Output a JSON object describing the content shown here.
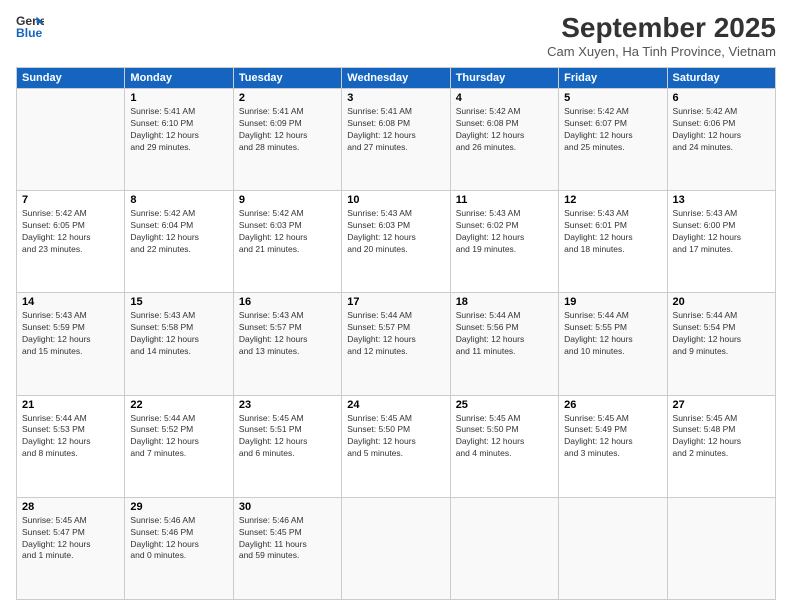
{
  "header": {
    "logo_line1": "General",
    "logo_line2": "Blue",
    "month_title": "September 2025",
    "subtitle": "Cam Xuyen, Ha Tinh Province, Vietnam"
  },
  "days_of_week": [
    "Sunday",
    "Monday",
    "Tuesday",
    "Wednesday",
    "Thursday",
    "Friday",
    "Saturday"
  ],
  "weeks": [
    [
      {
        "day": "",
        "info": ""
      },
      {
        "day": "1",
        "info": "Sunrise: 5:41 AM\nSunset: 6:10 PM\nDaylight: 12 hours\nand 29 minutes."
      },
      {
        "day": "2",
        "info": "Sunrise: 5:41 AM\nSunset: 6:09 PM\nDaylight: 12 hours\nand 28 minutes."
      },
      {
        "day": "3",
        "info": "Sunrise: 5:41 AM\nSunset: 6:08 PM\nDaylight: 12 hours\nand 27 minutes."
      },
      {
        "day": "4",
        "info": "Sunrise: 5:42 AM\nSunset: 6:08 PM\nDaylight: 12 hours\nand 26 minutes."
      },
      {
        "day": "5",
        "info": "Sunrise: 5:42 AM\nSunset: 6:07 PM\nDaylight: 12 hours\nand 25 minutes."
      },
      {
        "day": "6",
        "info": "Sunrise: 5:42 AM\nSunset: 6:06 PM\nDaylight: 12 hours\nand 24 minutes."
      }
    ],
    [
      {
        "day": "7",
        "info": "Sunrise: 5:42 AM\nSunset: 6:05 PM\nDaylight: 12 hours\nand 23 minutes."
      },
      {
        "day": "8",
        "info": "Sunrise: 5:42 AM\nSunset: 6:04 PM\nDaylight: 12 hours\nand 22 minutes."
      },
      {
        "day": "9",
        "info": "Sunrise: 5:42 AM\nSunset: 6:03 PM\nDaylight: 12 hours\nand 21 minutes."
      },
      {
        "day": "10",
        "info": "Sunrise: 5:43 AM\nSunset: 6:03 PM\nDaylight: 12 hours\nand 20 minutes."
      },
      {
        "day": "11",
        "info": "Sunrise: 5:43 AM\nSunset: 6:02 PM\nDaylight: 12 hours\nand 19 minutes."
      },
      {
        "day": "12",
        "info": "Sunrise: 5:43 AM\nSunset: 6:01 PM\nDaylight: 12 hours\nand 18 minutes."
      },
      {
        "day": "13",
        "info": "Sunrise: 5:43 AM\nSunset: 6:00 PM\nDaylight: 12 hours\nand 17 minutes."
      }
    ],
    [
      {
        "day": "14",
        "info": "Sunrise: 5:43 AM\nSunset: 5:59 PM\nDaylight: 12 hours\nand 15 minutes."
      },
      {
        "day": "15",
        "info": "Sunrise: 5:43 AM\nSunset: 5:58 PM\nDaylight: 12 hours\nand 14 minutes."
      },
      {
        "day": "16",
        "info": "Sunrise: 5:43 AM\nSunset: 5:57 PM\nDaylight: 12 hours\nand 13 minutes."
      },
      {
        "day": "17",
        "info": "Sunrise: 5:44 AM\nSunset: 5:57 PM\nDaylight: 12 hours\nand 12 minutes."
      },
      {
        "day": "18",
        "info": "Sunrise: 5:44 AM\nSunset: 5:56 PM\nDaylight: 12 hours\nand 11 minutes."
      },
      {
        "day": "19",
        "info": "Sunrise: 5:44 AM\nSunset: 5:55 PM\nDaylight: 12 hours\nand 10 minutes."
      },
      {
        "day": "20",
        "info": "Sunrise: 5:44 AM\nSunset: 5:54 PM\nDaylight: 12 hours\nand 9 minutes."
      }
    ],
    [
      {
        "day": "21",
        "info": "Sunrise: 5:44 AM\nSunset: 5:53 PM\nDaylight: 12 hours\nand 8 minutes."
      },
      {
        "day": "22",
        "info": "Sunrise: 5:44 AM\nSunset: 5:52 PM\nDaylight: 12 hours\nand 7 minutes."
      },
      {
        "day": "23",
        "info": "Sunrise: 5:45 AM\nSunset: 5:51 PM\nDaylight: 12 hours\nand 6 minutes."
      },
      {
        "day": "24",
        "info": "Sunrise: 5:45 AM\nSunset: 5:50 PM\nDaylight: 12 hours\nand 5 minutes."
      },
      {
        "day": "25",
        "info": "Sunrise: 5:45 AM\nSunset: 5:50 PM\nDaylight: 12 hours\nand 4 minutes."
      },
      {
        "day": "26",
        "info": "Sunrise: 5:45 AM\nSunset: 5:49 PM\nDaylight: 12 hours\nand 3 minutes."
      },
      {
        "day": "27",
        "info": "Sunrise: 5:45 AM\nSunset: 5:48 PM\nDaylight: 12 hours\nand 2 minutes."
      }
    ],
    [
      {
        "day": "28",
        "info": "Sunrise: 5:45 AM\nSunset: 5:47 PM\nDaylight: 12 hours\nand 1 minute."
      },
      {
        "day": "29",
        "info": "Sunrise: 5:46 AM\nSunset: 5:46 PM\nDaylight: 12 hours\nand 0 minutes."
      },
      {
        "day": "30",
        "info": "Sunrise: 5:46 AM\nSunset: 5:45 PM\nDaylight: 11 hours\nand 59 minutes."
      },
      {
        "day": "",
        "info": ""
      },
      {
        "day": "",
        "info": ""
      },
      {
        "day": "",
        "info": ""
      },
      {
        "day": "",
        "info": ""
      }
    ]
  ]
}
